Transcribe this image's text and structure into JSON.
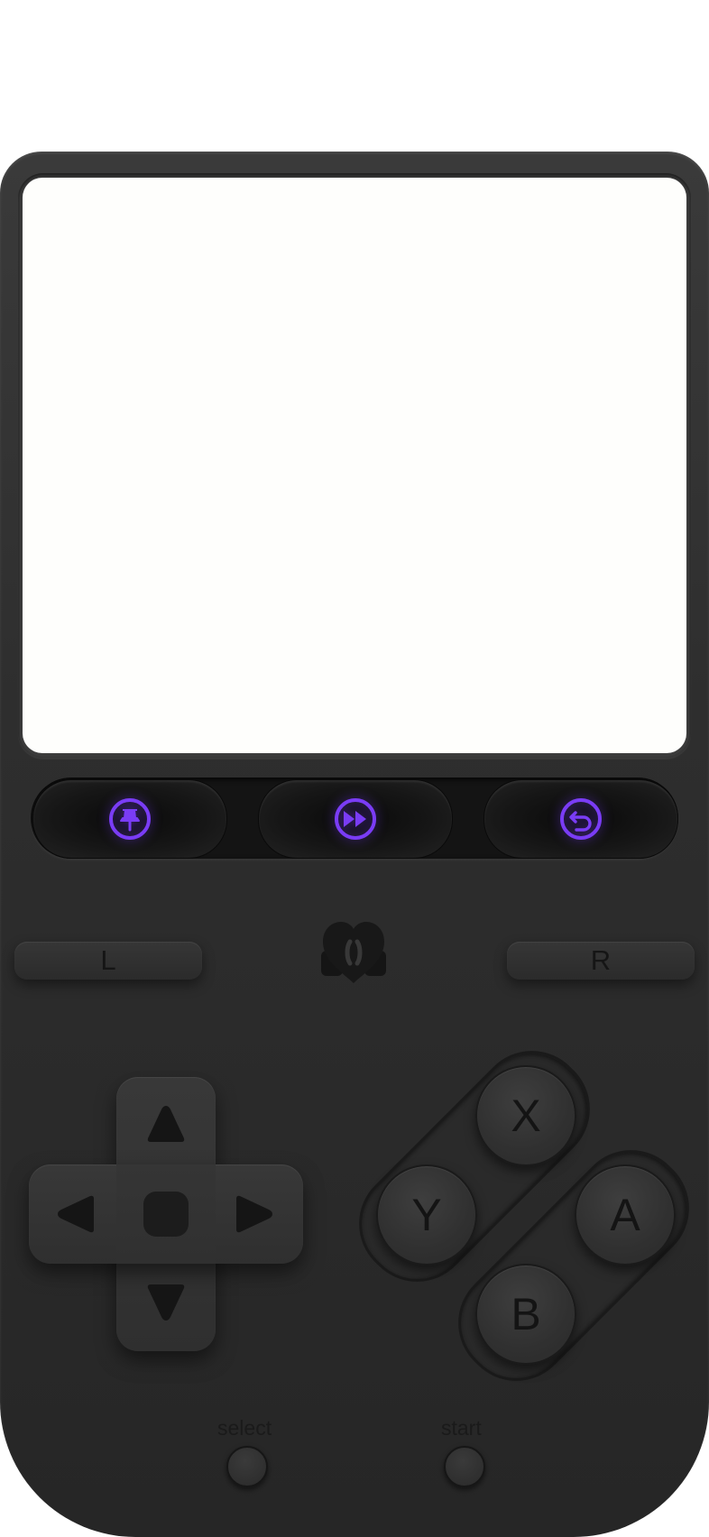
{
  "shoulders": {
    "left_label": "L",
    "right_label": "R"
  },
  "face_buttons": {
    "x": "X",
    "y": "Y",
    "a": "A",
    "b": "B"
  },
  "system": {
    "select_label": "select",
    "start_label": "start"
  },
  "function_buttons": [
    {
      "icon": "pin-icon"
    },
    {
      "icon": "fast-forward-icon"
    },
    {
      "icon": "rewind-icon"
    }
  ],
  "accent_color": "#7a3cf5"
}
